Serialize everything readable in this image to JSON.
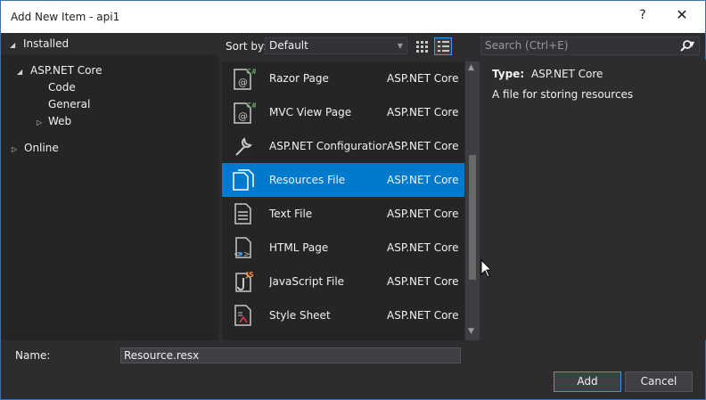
{
  "window": {
    "title": "Add New Item - api1",
    "help_label": "?",
    "close_label": "✕"
  },
  "left_pane": {
    "installed_label": "Installed",
    "tree": [
      {
        "label": "ASP.NET Core",
        "expanded": true
      },
      {
        "label": "Code"
      },
      {
        "label": "General"
      },
      {
        "label": "Web",
        "collapsed": true
      },
      {
        "label": "Online",
        "collapsed": true
      }
    ]
  },
  "toolbar": {
    "sort_label": "Sort by:",
    "sort_value": "Default"
  },
  "items": [
    {
      "name": "Razor Page",
      "category": "ASP.NET Core",
      "icon": "razor-page-icon"
    },
    {
      "name": "MVC View Page",
      "category": "ASP.NET Core",
      "icon": "mvc-view-page-icon"
    },
    {
      "name": "ASP.NET Configuration...",
      "category": "ASP.NET Core",
      "icon": "configuration-icon"
    },
    {
      "name": "Resources File",
      "category": "ASP.NET Core",
      "icon": "resources-file-icon",
      "selected": true
    },
    {
      "name": "Text File",
      "category": "ASP.NET Core",
      "icon": "text-file-icon"
    },
    {
      "name": "HTML Page",
      "category": "ASP.NET Core",
      "icon": "html-page-icon"
    },
    {
      "name": "JavaScript File",
      "category": "ASP.NET Core",
      "icon": "javascript-file-icon"
    },
    {
      "name": "Style Sheet",
      "category": "ASP.NET Core",
      "icon": "style-sheet-icon"
    }
  ],
  "search": {
    "placeholder": "Search (Ctrl+E)"
  },
  "details": {
    "type_label": "Type:",
    "type_value": "ASP.NET Core",
    "description": "A file for storing resources"
  },
  "footer": {
    "name_label": "Name:",
    "name_value": "Resource.resx",
    "add_label": "Add",
    "cancel_label": "Cancel"
  },
  "colors": {
    "selection": "#007acc",
    "background": "#2d2d30",
    "list_background": "#252526",
    "accent_border": "#3399ff"
  }
}
